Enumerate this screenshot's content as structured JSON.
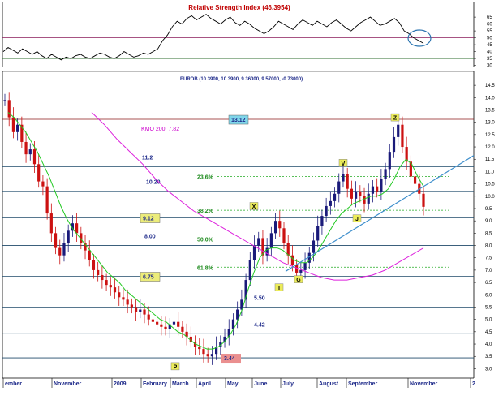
{
  "chart_data": {
    "type": "line",
    "symbol_label": "EUROB (10.3900, 10.3900, 9.36000, 9.57000, -0.73000)",
    "rsi": {
      "title": "Relative Strength Index (46.3954)",
      "y_ticks": [
        "65",
        "60",
        "55",
        "50",
        "45",
        "40",
        "35",
        "30"
      ],
      "levels": [
        50,
        35
      ],
      "ylim": [
        28,
        68
      ],
      "values": [
        40,
        43,
        41,
        39,
        42,
        40,
        38,
        40,
        37,
        35,
        38,
        36,
        34,
        36,
        35,
        37,
        38,
        36,
        35,
        37,
        39,
        38,
        36,
        35,
        37,
        40,
        38,
        36,
        37,
        39,
        38,
        40,
        42,
        48,
        52,
        58,
        62,
        60,
        64,
        66,
        63,
        65,
        67,
        64,
        62,
        60,
        63,
        65,
        61,
        59,
        62,
        60,
        57,
        55,
        53,
        55,
        58,
        62,
        60,
        58,
        56,
        60,
        63,
        61,
        59,
        62,
        60,
        58,
        61,
        63,
        60,
        57,
        55,
        58,
        61,
        63,
        65,
        62,
        59,
        60,
        62,
        64,
        61,
        55,
        53,
        50,
        48,
        46
      ]
    },
    "price": {
      "ylim": [
        2.75,
        14.8
      ],
      "y_ticks": [
        "14.5",
        "14.0",
        "13.5",
        "13.0",
        "12.5",
        "12.0",
        "11.5",
        "11.0",
        "10.5",
        "10.0",
        "9.5",
        "9.0",
        "8.5",
        "8.0",
        "7.5",
        "7.0",
        "6.5",
        "6.0",
        "5.5",
        "5.0",
        "4.5",
        "4.0",
        "3.5",
        "3.0"
      ],
      "close": [
        13.9,
        13.2,
        12.6,
        12.9,
        12.2,
        11.7,
        11.9,
        11.3,
        10.6,
        10.4,
        9.3,
        8.5,
        7.9,
        7.6,
        8.1,
        8.6,
        8.9,
        8.5,
        8.1,
        7.8,
        7.4,
        7.0,
        6.8,
        6.6,
        6.4,
        6.3,
        6.1,
        5.9,
        5.8,
        5.6,
        5.5,
        5.3,
        5.4,
        5.2,
        5.0,
        4.9,
        4.8,
        4.7,
        4.6,
        4.8,
        4.9,
        4.7,
        4.5,
        4.3,
        4.1,
        3.9,
        3.8,
        3.6,
        3.5,
        3.6,
        3.9,
        4.1,
        4.3,
        4.6,
        5.0,
        5.4,
        5.8,
        6.6,
        7.4,
        8.0,
        8.3,
        7.6,
        7.9,
        8.5,
        9.0,
        8.7,
        8.1,
        7.6,
        7.2,
        6.9,
        7.0,
        7.3,
        7.7,
        8.2,
        8.8,
        9.2,
        9.6,
        9.8,
        10.1,
        10.6,
        10.9,
        10.3,
        9.9,
        10.2,
        10.0,
        9.7,
        10.1,
        10.4,
        10.2,
        10.7,
        11.1,
        11.8,
        12.4,
        12.9,
        12.0,
        11.4,
        10.8,
        10.5,
        10.1,
        9.57
      ],
      "sma": [
        13.4,
        13.2,
        12.9,
        12.6,
        12.2,
        11.8,
        11.3,
        10.8,
        10.2,
        9.6,
        9.1,
        8.7,
        8.4,
        8.1,
        7.8,
        7.5,
        7.2,
        6.9,
        6.7,
        6.5,
        6.2,
        6.0,
        5.8,
        5.6,
        5.4,
        5.2,
        5.0,
        4.9,
        4.7,
        4.5,
        4.4,
        4.2,
        4.0,
        3.9,
        3.8,
        3.8,
        3.9,
        4.1,
        4.4,
        4.8,
        5.4,
        6.2,
        6.9,
        7.5,
        7.8,
        7.9,
        7.9,
        7.8,
        7.6,
        7.4,
        7.3,
        7.3,
        7.5,
        7.8,
        8.2,
        8.6,
        9.0,
        9.3,
        9.5,
        9.7,
        9.8,
        9.9,
        10.0,
        10.0,
        10.1,
        10.3,
        10.7,
        11.2,
        11.5,
        11.3,
        10.8,
        10.4
      ],
      "kmo200": [
        13.4,
        12.9,
        12.3,
        11.8,
        11.3,
        10.7,
        10.2,
        9.8,
        9.4,
        9.1,
        8.8,
        8.5,
        8.2,
        7.9,
        7.6,
        7.3,
        7.1,
        6.9,
        6.7,
        6.6,
        6.6,
        6.7,
        6.8,
        7.0,
        7.3,
        7.6,
        7.9
      ],
      "hlines": [
        {
          "value": 13.12,
          "label": "13.12",
          "boxed": "cyan"
        },
        {
          "value": 11.2,
          "label": "11.2",
          "boxed": ""
        },
        {
          "value": 10.2,
          "label": "10.20",
          "boxed": ""
        },
        {
          "value": 9.12,
          "label": "9.12",
          "boxed": "yellow"
        },
        {
          "value": 8.0,
          "label": "8.00",
          "boxed": ""
        },
        {
          "value": 6.75,
          "label": "6.75",
          "boxed": "yellow"
        },
        {
          "value": 5.5,
          "label": "5.50",
          "boxed": ""
        },
        {
          "value": 4.42,
          "label": "4.42",
          "boxed": ""
        },
        {
          "value": 3.44,
          "label": "3.44",
          "boxed": "red"
        }
      ],
      "fibs": [
        {
          "value": 10.8,
          "label": "23.6%"
        },
        {
          "value": 9.43,
          "label": "38.2%"
        },
        {
          "value": 8.27,
          "label": "50.0%"
        },
        {
          "value": 7.12,
          "label": "61.8%"
        }
      ],
      "kmo_label": "KMO 200: 7.82",
      "wave_labels": [
        "X",
        "T",
        "G",
        "V",
        "J",
        "Z",
        "P"
      ],
      "x_ticks": [
        "ember",
        "November",
        "2009",
        "February",
        "March",
        "April",
        "May",
        "June",
        "July",
        "August",
        "September",
        "November",
        "2"
      ]
    }
  }
}
